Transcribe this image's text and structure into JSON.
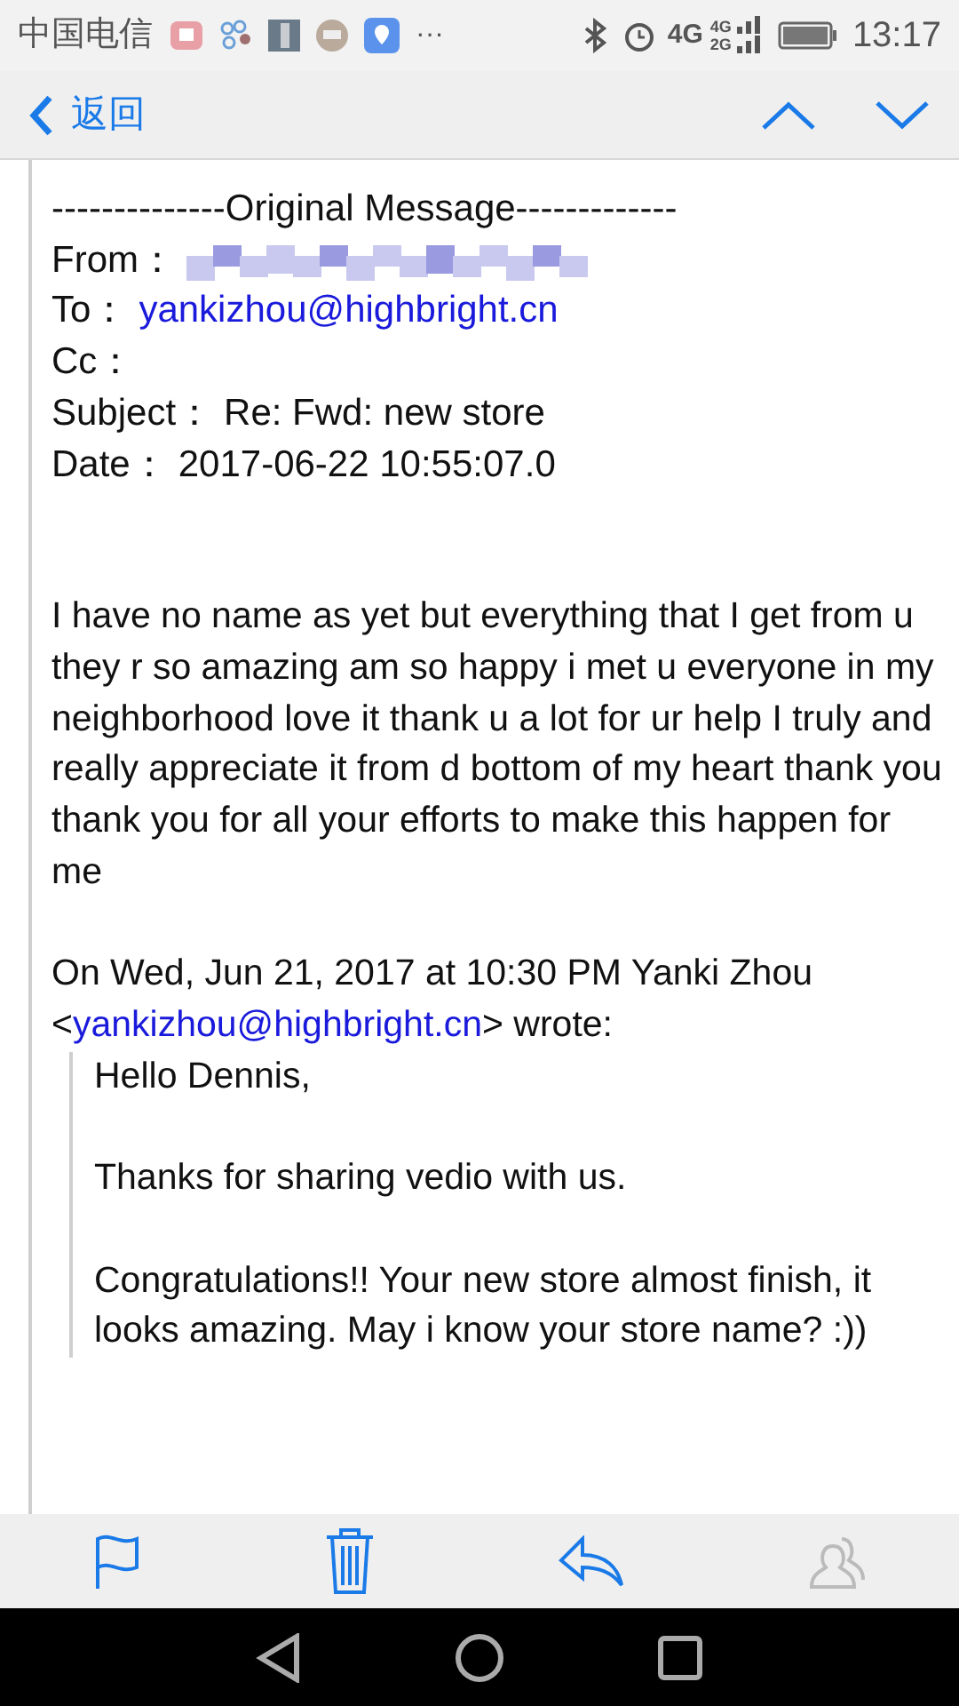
{
  "status_bar": {
    "carrier": "中国电信",
    "more": "···",
    "network": "4G",
    "sim_networks": [
      "4G",
      "2G"
    ],
    "time": "13:17"
  },
  "header": {
    "back_label": "返回"
  },
  "message": {
    "separator": "--------------Original Message-------------",
    "fields": [
      {
        "label": "From：",
        "kind": "redacted"
      },
      {
        "label": "To：",
        "kind": "link",
        "value": "yankizhou@highbright.cn"
      },
      {
        "label": "Cc：",
        "kind": "empty"
      },
      {
        "label": "Subject：",
        "kind": "text",
        "value": "Re: Fwd: new store"
      },
      {
        "label": "Date：",
        "kind": "text",
        "value": "2017-06-22 10:55:07.0"
      }
    ],
    "body": "I have no name as yet but everything that I get from u they r so amazing am so happy i met u everyone in my neighborhood love it thank u a lot for ur help I truly and really appreciate it from d bottom of my heart thank you thank you for all your efforts to make this happen for me",
    "quote_intro": {
      "before": "On Wed, Jun 21, 2017 at 10:30 PM Yanki Zhou <",
      "email": "yankizhou@highbright.cn",
      "after": "> wrote:"
    },
    "quoted": [
      "Hello Dennis,",
      "Thanks for sharing vedio with us.",
      "Congratulations!! Your new store almost finish, it looks amazing. May i know your store name? :))"
    ]
  }
}
